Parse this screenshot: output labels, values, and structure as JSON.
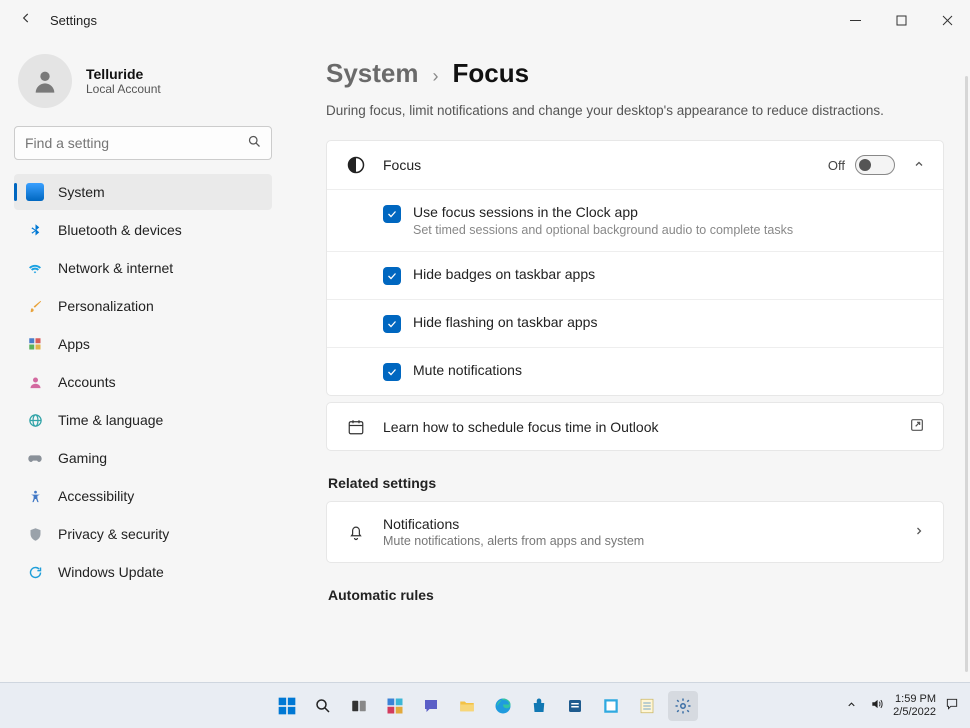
{
  "titlebar": {
    "app_title": "Settings"
  },
  "profile": {
    "name": "Telluride",
    "sub": "Local Account"
  },
  "search": {
    "placeholder": "Find a setting"
  },
  "sidebar": {
    "items": [
      {
        "label": "System"
      },
      {
        "label": "Bluetooth & devices"
      },
      {
        "label": "Network & internet"
      },
      {
        "label": "Personalization"
      },
      {
        "label": "Apps"
      },
      {
        "label": "Accounts"
      },
      {
        "label": "Time & language"
      },
      {
        "label": "Gaming"
      },
      {
        "label": "Accessibility"
      },
      {
        "label": "Privacy & security"
      },
      {
        "label": "Windows Update"
      }
    ]
  },
  "breadcrumb": {
    "parent": "System",
    "current": "Focus"
  },
  "page": {
    "description": "During focus, limit notifications and change your desktop's appearance to reduce distractions.",
    "focus_card": {
      "title": "Focus",
      "toggle_state": "Off",
      "options": [
        {
          "label": "Use focus sessions in the Clock app",
          "sub": "Set timed sessions and optional background audio to complete tasks"
        },
        {
          "label": "Hide badges on taskbar apps"
        },
        {
          "label": "Hide flashing on taskbar apps"
        },
        {
          "label": "Mute notifications"
        }
      ]
    },
    "outlook_link": "Learn how to schedule focus time in Outlook",
    "related_title": "Related settings",
    "notifications_card": {
      "title": "Notifications",
      "sub": "Mute notifications, alerts from apps and system"
    },
    "auto_rules_title": "Automatic rules"
  },
  "taskbar": {
    "time": "1:59 PM",
    "date": "2/5/2022"
  }
}
